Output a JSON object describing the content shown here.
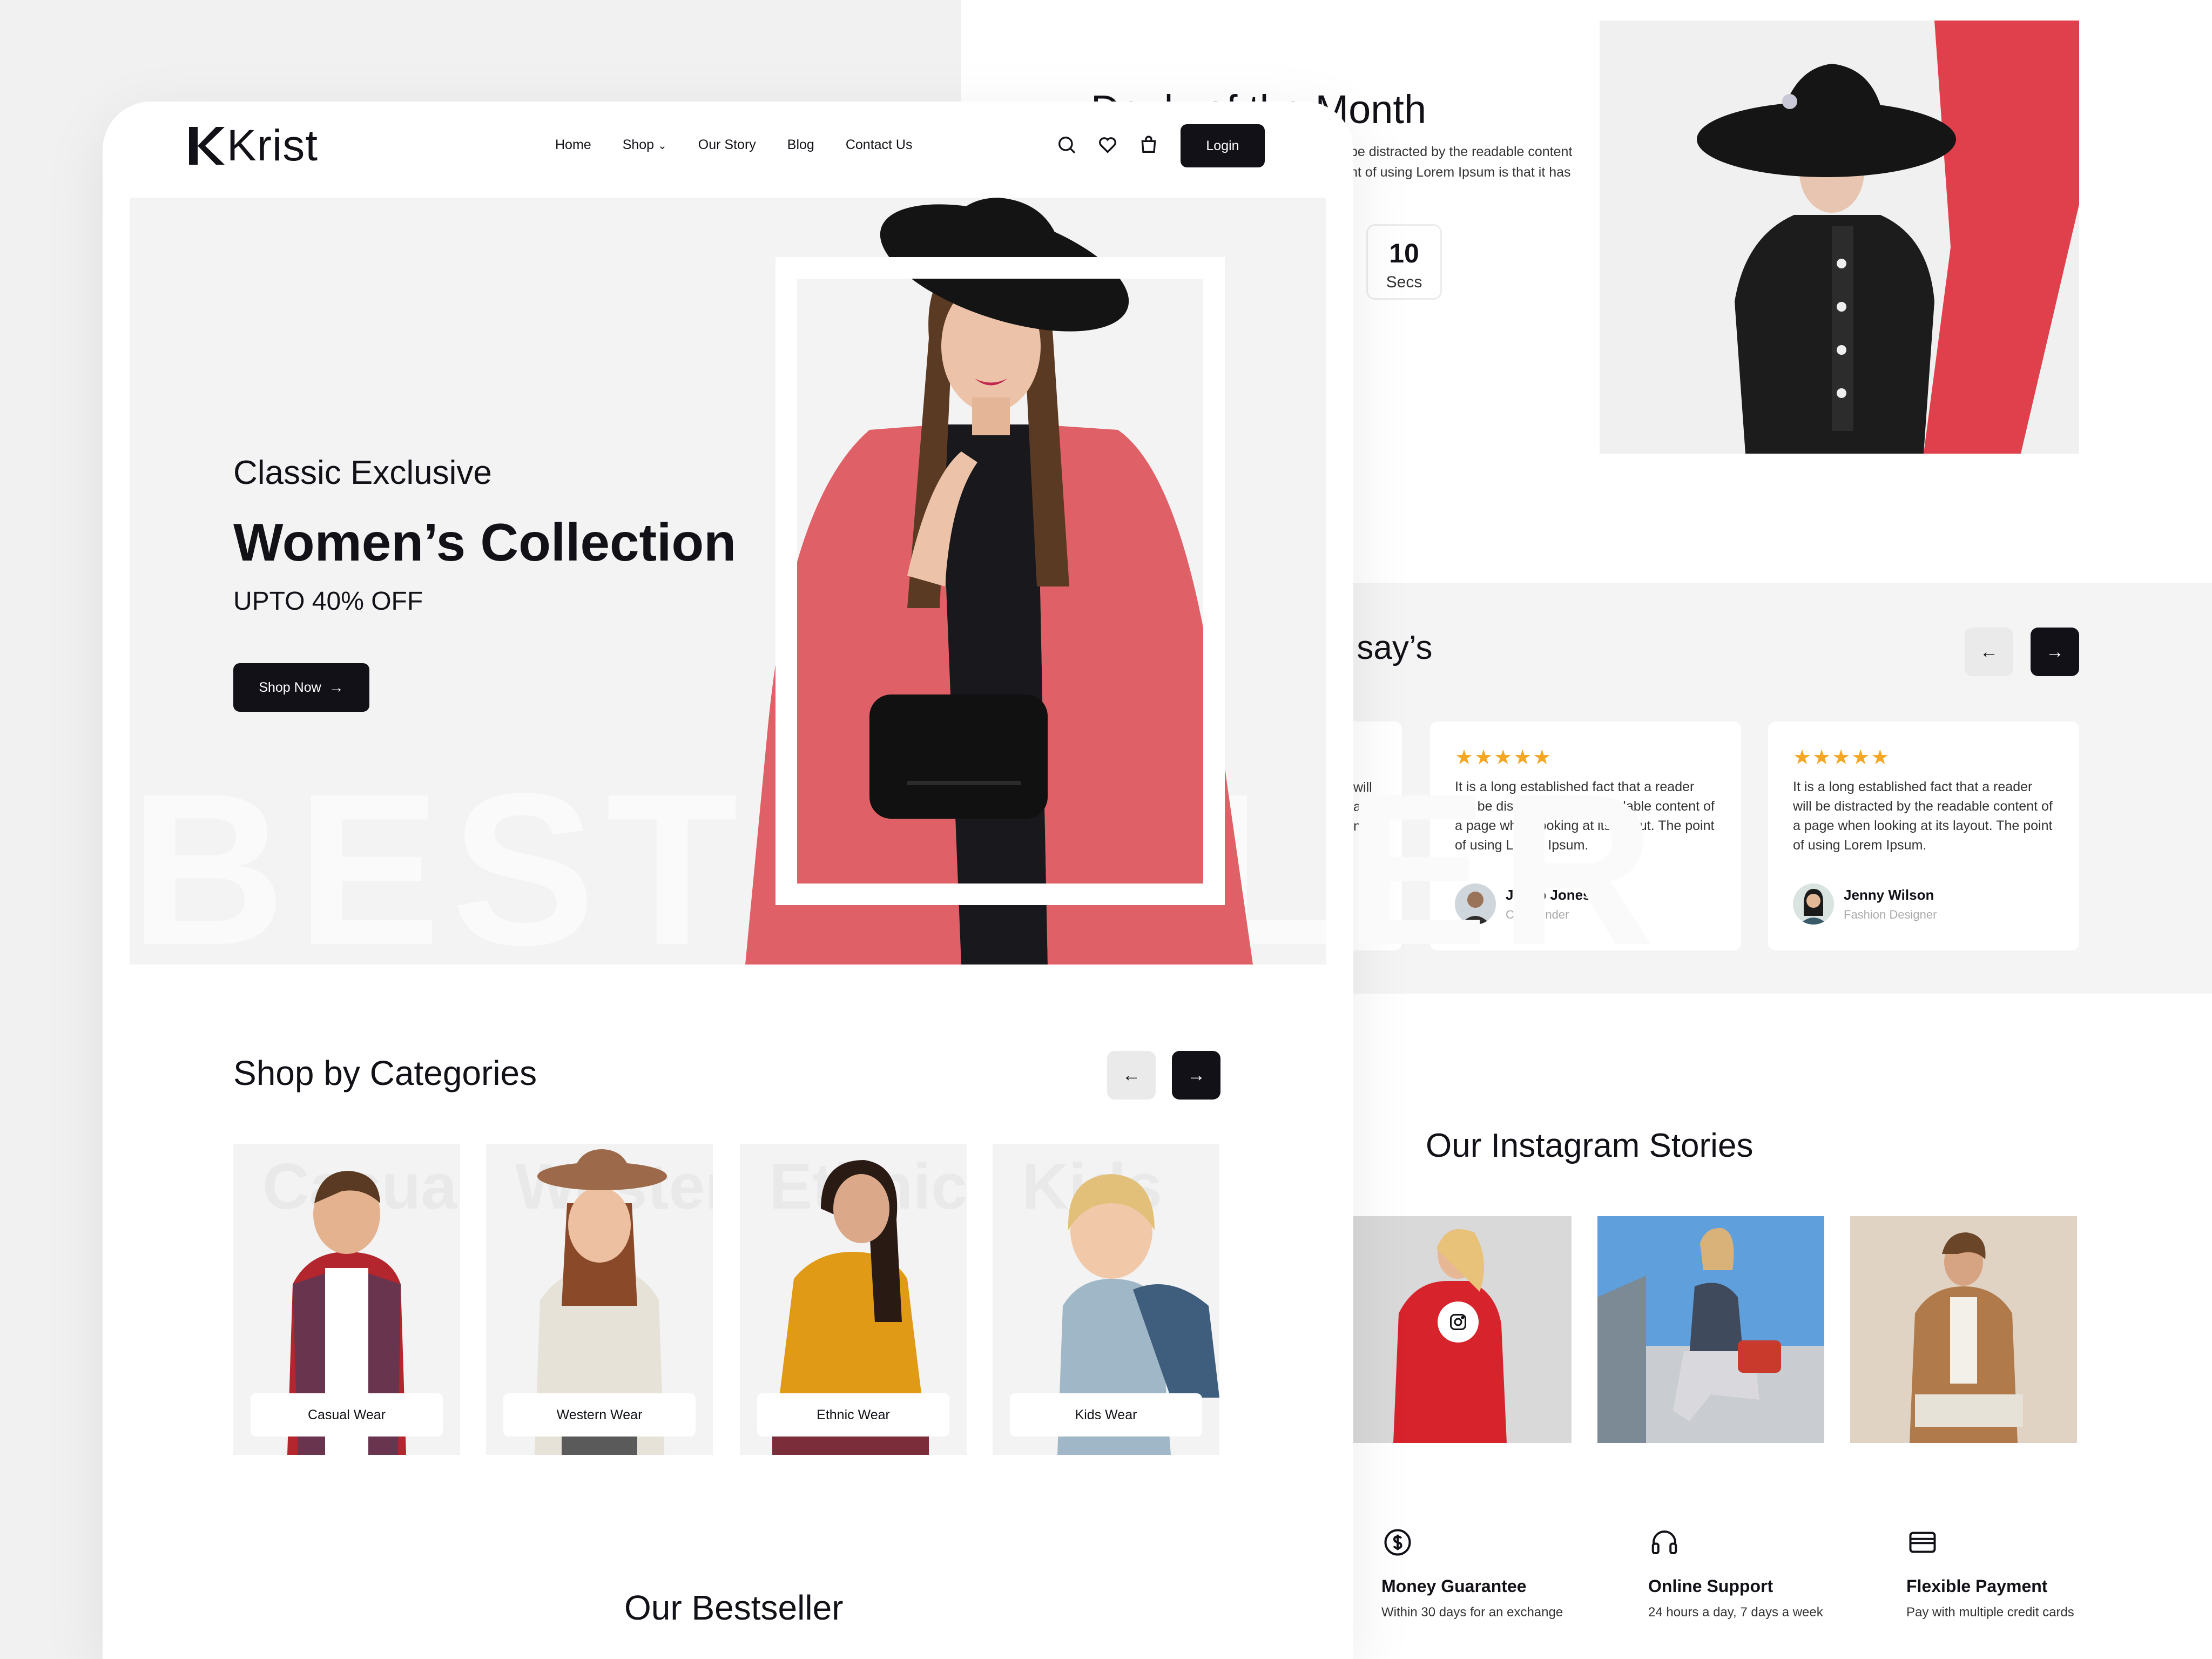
{
  "brand": {
    "logo_text": "Krist"
  },
  "nav": {
    "items": [
      "Home",
      "Shop",
      "Our Story",
      "Blog",
      "Contact Us"
    ],
    "login_label": "Login"
  },
  "hero": {
    "eyebrow": "Classic Exclusive",
    "title": "Women’s Collection",
    "offer": "UPTO 40% OFF",
    "cta_label": "Shop Now",
    "bg_text": "BESTSELLER"
  },
  "categories": {
    "title": "Shop by Categories",
    "items": [
      {
        "label": "Casual Wear",
        "bg_word": "Casual"
      },
      {
        "label": "Western Wear",
        "bg_word": "Western"
      },
      {
        "label": "Ethnic Wear",
        "bg_word": "Ethnic"
      },
      {
        "label": "Kids Wear",
        "bg_word": "Kids"
      }
    ]
  },
  "bestseller": {
    "title": "Our Bestseller"
  },
  "deal": {
    "title": "Deals of the Month",
    "text_line1": "be distracted by the readable content",
    "text_line2": "nt of using Lorem Ipsum is that it has",
    "timer": {
      "value": "10",
      "unit": "Secs"
    }
  },
  "testimonials": {
    "title_fragment": "er say’s",
    "partial_card_lines": [
      "will",
      "a",
      "nt of"
    ],
    "cards": [
      {
        "stars": "★★★★★",
        "text": "It is a long established fact that a reader will be distracted by the readable content of a page when looking at its layout. The point of using Lorem Ipsum.",
        "name": "Jacob Jones",
        "role": "Co-Founder"
      },
      {
        "stars": "★★★★★",
        "text": "It is a long established fact that a reader will be distracted by the readable content of a page when looking at its layout. The point of using Lorem Ipsum.",
        "name": "Jenny Wilson",
        "role": "Fashion Designer"
      }
    ]
  },
  "instagram": {
    "title": "Our Instagram Stories"
  },
  "features": [
    {
      "icon": "dollar-coin-icon",
      "title": "Money Guarantee",
      "subtitle": "Within 30 days for an exchange"
    },
    {
      "icon": "headphones-icon",
      "title": "Online Support",
      "subtitle": "24 hours a day, 7 days a week"
    },
    {
      "icon": "credit-card-icon",
      "title": "Flexible Payment",
      "subtitle": "Pay with multiple credit cards"
    }
  ],
  "colors": {
    "dark": "#131118",
    "accent_red": "#e0404c",
    "coat_coral": "#e06067",
    "star_orange": "#f5a623",
    "light_gray": "#f3f3f3"
  }
}
